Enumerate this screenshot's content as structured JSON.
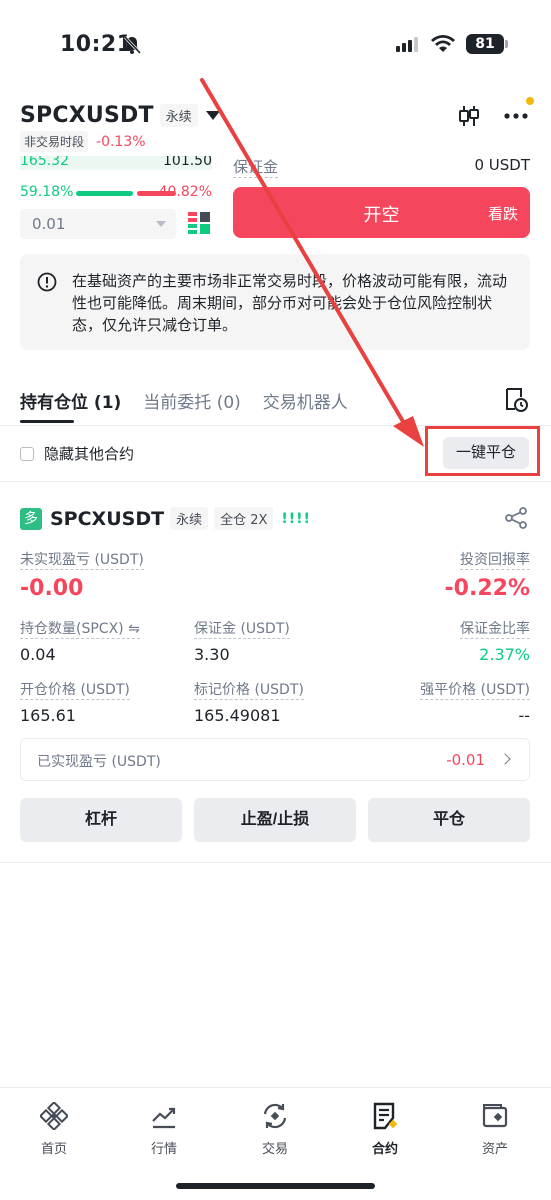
{
  "status_bar": {
    "time": "10:21",
    "battery": "81"
  },
  "header": {
    "symbol": "SPCXUSDT",
    "contract_tag": "永续",
    "session_tag": "非交易时段",
    "change": "-0.13%"
  },
  "order_book": {
    "price": "165.32",
    "amount": "101.50",
    "buy_ratio": "59.18%",
    "sell_ratio": "40.82%",
    "buy_fraction": 0.5918,
    "precision": "0.01"
  },
  "trade_panel": {
    "margin_label": "保证金",
    "margin_value": "0 USDT",
    "short_button_label": "开空",
    "short_button_sub": "看跌"
  },
  "notice": {
    "text": "在基础资产的主要市场非正常交易时段，价格波动可能有限，流动性也可能降低。周末期间，部分币对可能会处于仓位风险控制状态，仅允许只减仓订单。"
  },
  "tabs": [
    {
      "label": "持有仓位",
      "count": "(1)"
    },
    {
      "label": "当前委托",
      "count": "(0)"
    },
    {
      "label": "交易机器人",
      "count": ""
    }
  ],
  "hide_other_label": "隐藏其他合约",
  "close_all_label": "一键平仓",
  "position": {
    "badge": "多",
    "symbol": "SPCXUSDT",
    "contract_tag": "永续",
    "leverage_tag": "全仓 2X",
    "bars": "!!!!",
    "unrealized_label": "未实现盈亏 (USDT)",
    "unrealized_value": "-0.00",
    "roi_label": "投资回报率",
    "roi_value": "-0.22%",
    "size_label": "持仓数量(SPCX)",
    "size_value": "0.04",
    "margin_label": "保证金 (USDT)",
    "margin_value": "3.30",
    "margin_ratio_label": "保证金比率",
    "margin_ratio_value": "2.37%",
    "entry_label": "开仓价格 (USDT)",
    "entry_value": "165.61",
    "mark_label": "标记价格 (USDT)",
    "mark_value": "165.49081",
    "liq_label": "强平价格 (USDT)",
    "liq_value": "--",
    "realized_label": "已实现盈亏 (USDT)",
    "realized_value": "-0.01",
    "buttons": {
      "leverage": "杠杆",
      "tpsl": "止盈/止损",
      "close": "平仓"
    }
  },
  "bottom_nav": [
    {
      "label": "首页",
      "icon": "binance-logo-icon"
    },
    {
      "label": "行情",
      "icon": "chart-icon"
    },
    {
      "label": "交易",
      "icon": "trade-icon"
    },
    {
      "label": "合约",
      "icon": "futures-icon"
    },
    {
      "label": "资产",
      "icon": "wallet-icon"
    }
  ],
  "colors": {
    "red": "#f6465d",
    "green": "#0ecb81",
    "brand": "#f0b90b",
    "annotation": "#e8413f"
  }
}
